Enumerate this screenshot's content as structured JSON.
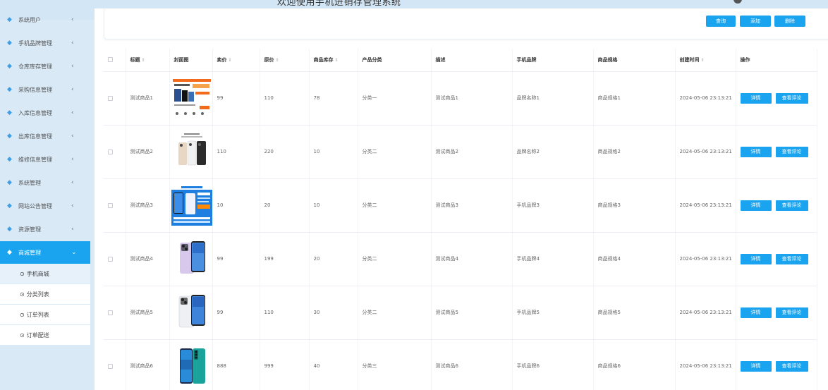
{
  "header": {
    "welcome": "欢迎使用手机进销存管理系统"
  },
  "sidebar": {
    "items": [
      {
        "label": "系统用户"
      },
      {
        "label": "手机品牌管理"
      },
      {
        "label": "仓库库存管理"
      },
      {
        "label": "采购信息管理"
      },
      {
        "label": "入库信息管理"
      },
      {
        "label": "出库信息管理"
      },
      {
        "label": "维修信息管理"
      },
      {
        "label": "系统管理"
      },
      {
        "label": "网站公告管理"
      },
      {
        "label": "资源管理"
      },
      {
        "label": "商城管理",
        "active": true
      }
    ],
    "sub_items": [
      {
        "label": "手机商城"
      },
      {
        "label": "分类列表"
      },
      {
        "label": "订单列表"
      },
      {
        "label": "订单配送"
      }
    ]
  },
  "toolbar": {
    "query_label": "查询",
    "add_label": "添加",
    "delete_label": "删除"
  },
  "table": {
    "columns": [
      "标题",
      "封面图",
      "卖价",
      "原价",
      "商品库存",
      "产品分类",
      "描述",
      "手机品牌",
      "商品规格",
      "创建时间",
      "操作"
    ],
    "rows": [
      {
        "title": "测试商品1",
        "price": "99",
        "orig": "110",
        "stock": "78",
        "category": "分类一",
        "desc": "测试商品1",
        "brand": "品牌名称1",
        "spec": "商品规格1",
        "time": "2024-05-06 23:13:21",
        "img": "phone-ad"
      },
      {
        "title": "测试商品2",
        "price": "110",
        "orig": "220",
        "stock": "10",
        "category": "分类二",
        "desc": "测试商品2",
        "brand": "品牌名称2",
        "spec": "商品规格2",
        "time": "2024-05-06 23:13:21",
        "img": "phone-trio"
      },
      {
        "title": "测试商品3",
        "price": "10",
        "orig": "20",
        "stock": "10",
        "category": "分类二",
        "desc": "测试商品3",
        "brand": "手机品牌3",
        "spec": "商品规格3",
        "time": "2024-05-06 23:13:21",
        "img": "phone-blue-banner"
      },
      {
        "title": "测试商品4",
        "price": "99",
        "orig": "199",
        "stock": "20",
        "category": "分类二",
        "desc": "测试商品4",
        "brand": "手机品牌4",
        "spec": "商品规格4",
        "time": "2024-05-06 23:13:21",
        "img": "phone-purple"
      },
      {
        "title": "测试商品5",
        "price": "99",
        "orig": "110",
        "stock": "30",
        "category": "分类二",
        "desc": "测试商品5",
        "brand": "手机品牌5",
        "spec": "商品规格5",
        "time": "2024-05-06 23:13:21",
        "img": "phone-silver"
      },
      {
        "title": "测试商品6",
        "price": "888",
        "orig": "999",
        "stock": "40",
        "category": "分类三",
        "desc": "测试商品6",
        "brand": "手机品牌6",
        "spec": "商品规格6",
        "time": "2024-05-06 23:13:21",
        "img": "phone-teal"
      }
    ],
    "action_detail": "详情",
    "action_comment": "查看评论"
  },
  "colors": {
    "accent": "#1aa3ee",
    "page_bg": "#d9e9f6"
  }
}
